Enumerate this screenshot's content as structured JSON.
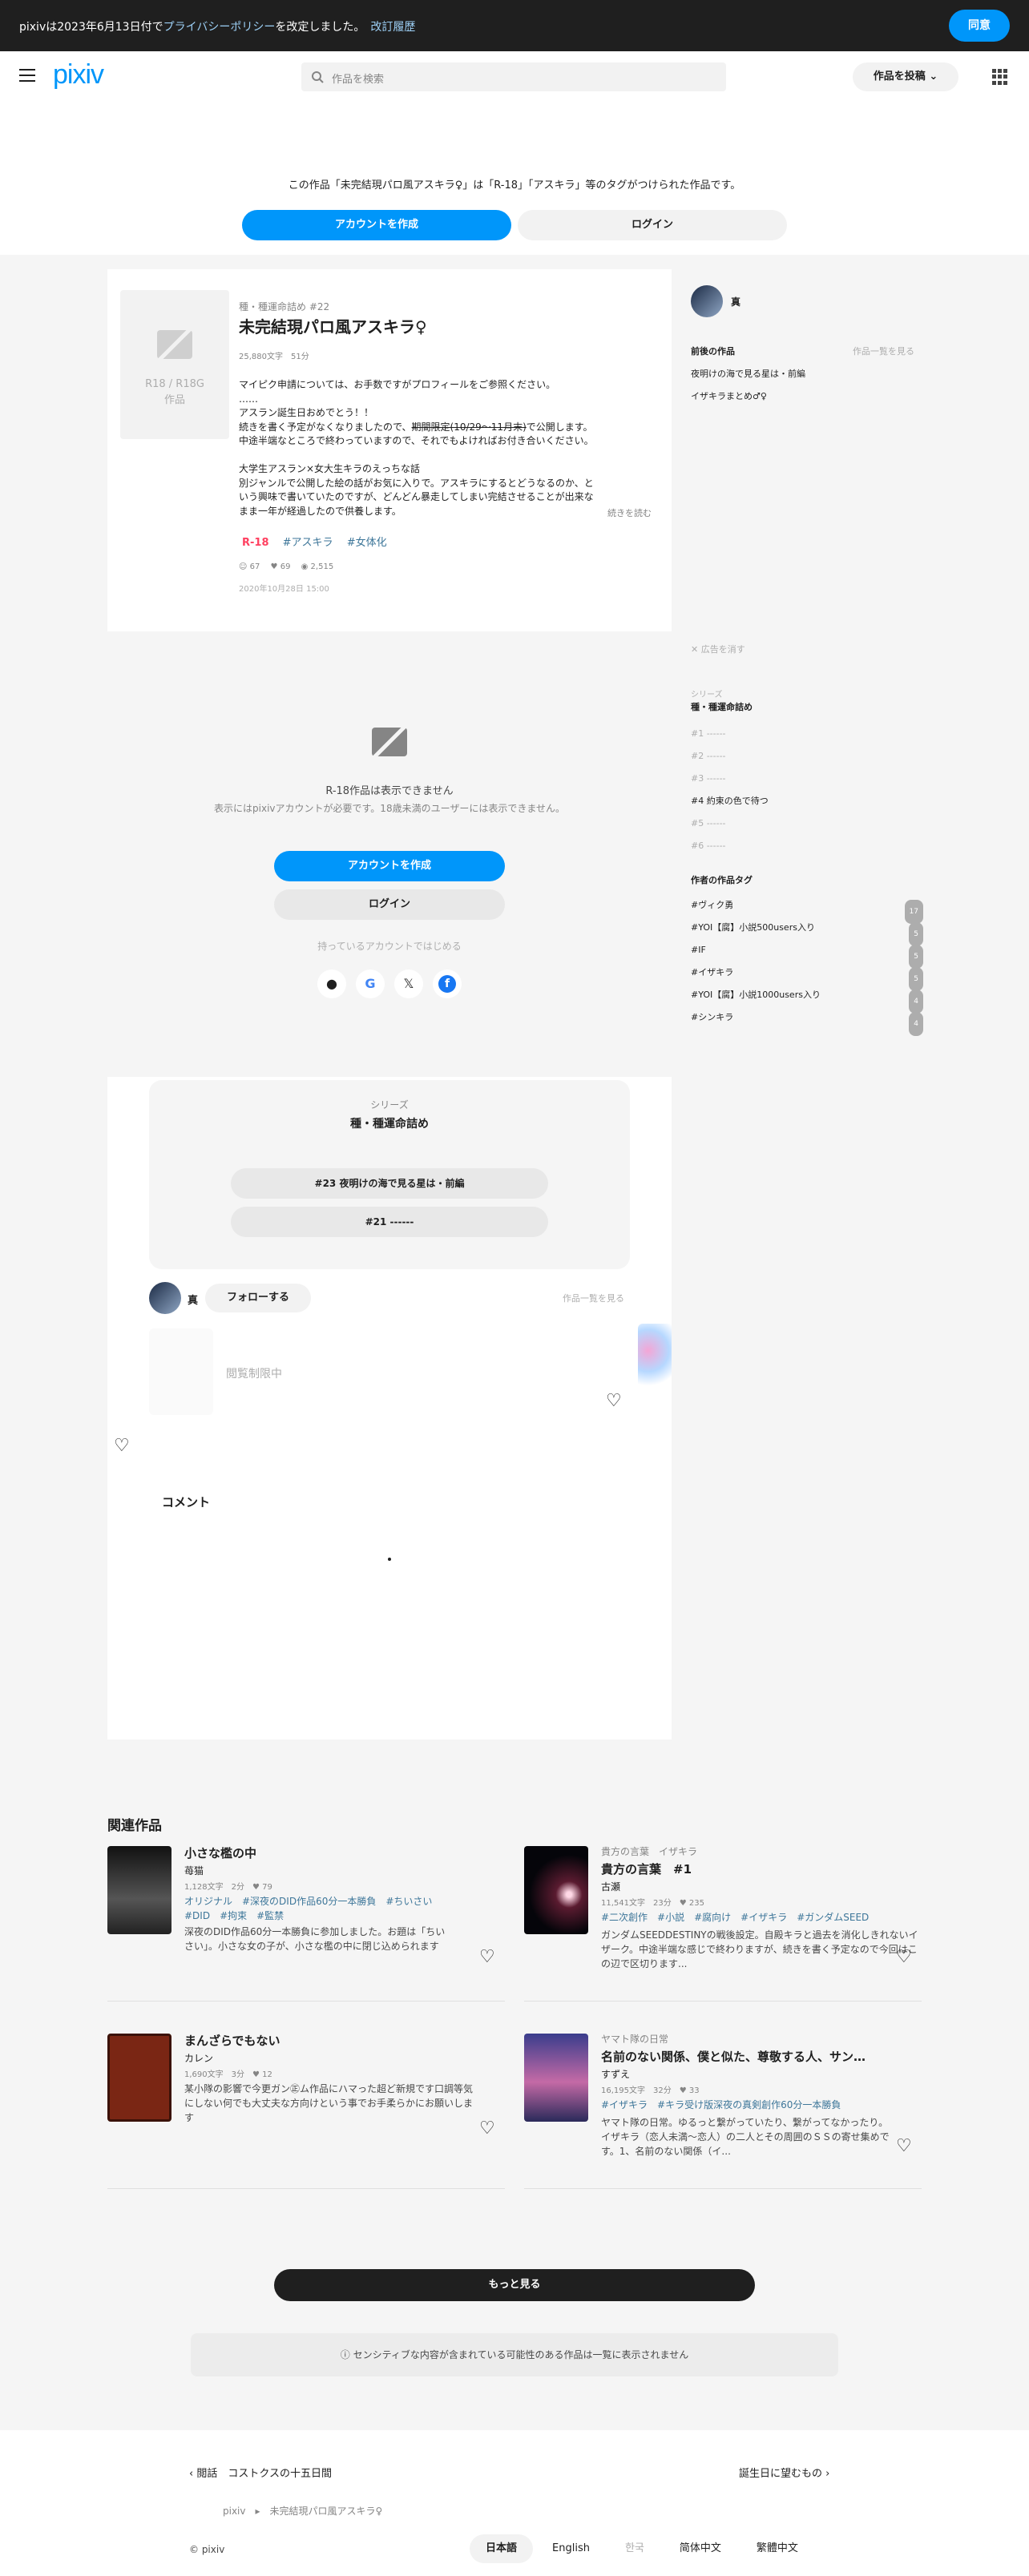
{
  "consent": {
    "text_pre": "pixivは2023年6月13日付で",
    "policy": "プライバシーポリシー",
    "text_post": "を改定しました。",
    "history": "改訂履歴",
    "agree": "同意"
  },
  "header": {
    "logo": "pixiv",
    "search_placeholder": "作品を検索",
    "post": "作品を投稿"
  },
  "gate": {
    "message": "この作品「未完結現パロ風アスキラ♀」は「R-18」「アスキラ」等のタグがつけられた作品です。",
    "create": "アカウントを作成",
    "login": "ログイン"
  },
  "work": {
    "placeholder": "R18 / R18G\n作品",
    "series": "種・種運命詰め #22",
    "title": "未完結現パロ風アスキラ♀",
    "meta": "25,880文字　51分",
    "caption": [
      "マイピク申請については、お手数ですがプロフィールをご参照ください。",
      "……",
      "アスラン誕生日おめでとう！！",
      "続きを書く予定がなくなりましたので、",
      "期間限定(10/29〜11月末)",
      "で公開します。",
      "中途半端なところで終わっていますので、それでもよければお付き合いください。",
      "",
      "大学生アスラン×女大生キラのえっちな話",
      "別ジャンルで公開した絵の話がお気に入りで。アスキラにするとどうなるのか、と",
      "いう興味で書いていたのですが、どんどん暴走してしまい完結させることが出来な",
      "まま一年が経過したので供養します。"
    ],
    "read_more": "続きを読む",
    "tags": [
      "R-18",
      "#アスキラ",
      "#女体化"
    ],
    "stats": {
      "likes": "67",
      "hearts": "69",
      "views": "2,515"
    },
    "date": "2020年10月28日 15:00"
  },
  "r18": {
    "title": "R-18作品は表示できません",
    "desc": "表示にはpixivアカウントが必要です。18歳未満のユーザーには表示できません。",
    "create": "アカウントを作成",
    "login": "ログイン",
    "alt": "持っているアカウントではじめる"
  },
  "series_box": {
    "label": "シリーズ",
    "title": "種・種運命詰め",
    "next": "#23 夜明けの海で見る星は・前編",
    "prev": "#21 ------"
  },
  "author_row": {
    "name": "真",
    "follow": "フォローする",
    "list": "作品一覧を見る",
    "restricted": "閲覧制限中"
  },
  "comments": {
    "title": "コメント"
  },
  "side": {
    "name": "真",
    "prevnext": "前後の作品",
    "list": "作品一覧を見る",
    "links": [
      "夜明けの海で見る星は・前編",
      "イザキラまとめ♂♀"
    ],
    "ad_close": "✕ 広告を消す",
    "series_label": "シリーズ",
    "series_title": "種・種運命詰め",
    "series_items": [
      "#1 ------",
      "#2 ------",
      "#3 ------",
      "#4 約束の色で待つ",
      "#5 ------",
      "#6 ------"
    ],
    "tags_title": "作者の作品タグ",
    "tags": [
      {
        "name": "#ヴィク勇",
        "count": "17"
      },
      {
        "name": "#YOI【腐】小説500users入り",
        "count": "5"
      },
      {
        "name": "#IF",
        "count": "5"
      },
      {
        "name": "#イザキラ",
        "count": "5"
      },
      {
        "name": "#YOI【腐】小説1000users入り",
        "count": "4"
      },
      {
        "name": "#シンキラ",
        "count": "4"
      }
    ]
  },
  "related": {
    "title": "関連作品",
    "items": [
      {
        "series": "",
        "title": "小さな檻の中",
        "author": "苺猫",
        "meta": "1,128文字　2分　♥ 79",
        "tags": "オリジナル　#深夜のDID作品60分一本勝負　#ちいさい　#DID　#拘束　#監禁",
        "desc": "深夜のDID作品60分一本勝負に参加しました。お題は「ちいさい」。小さな女の子が、小さな檻の中に閉じ込められます"
      },
      {
        "series": "貴方の言葉　イザキラ",
        "title": "貴方の言葉　#1",
        "author": "古瀬",
        "meta": "11,541文字　23分　♥ 235",
        "tags": "#二次創作　#小説　#腐向け　#イザキラ　#ガンダムSEED",
        "desc": "ガンダムSEEDDESTINYの戦後設定。自殿キラと過去を消化しきれないイザーク。中途半端な感じで終わりますが、続きを書く予定なので今回はこの辺で区切ります..."
      },
      {
        "series": "",
        "title": "まんざらでもない",
        "author": "カレン",
        "meta": "1,690文字　3分　♥ 12",
        "tags": "#イザキラ",
        "desc": "某小隊の影響で今更ガン㊣ム作品にハマった超ど新規です口調等気にしない何でも大丈夫な方向けという事でお手柔らかにお願いします"
      },
      {
        "series": "ヤマト隊の日常",
        "title": "名前のない関係、僕と似た、尊敬する人、サン…",
        "author": "すずえ",
        "meta": "16,195文字　32分　♥ 33",
        "tags": "#イザキラ　#キラ受け版深夜の真剣創作60分一本勝負",
        "desc": "ヤマト隊の日常。ゆるっと繋がっていたり、繋がってなかったり。イザキラ（恋人未満〜恋人）の二人とその周囲のＳＳの寄せ集めです。1、名前のない関係（イ..."
      }
    ]
  },
  "more": "もっと見る",
  "sensitive": "センシティブな内容が含まれている可能性のある作品は一覧に表示されません",
  "footer": {
    "prev": "閲話　コストクスの十五日間",
    "next": "誕生日に望むもの",
    "bc_root": "pixiv",
    "bc_current": "未完結現パロ風アスキラ♀",
    "copy": "© pixiv",
    "langs": [
      "日本語",
      "English",
      "한국",
      "简体中文",
      "繁體中文"
    ]
  }
}
